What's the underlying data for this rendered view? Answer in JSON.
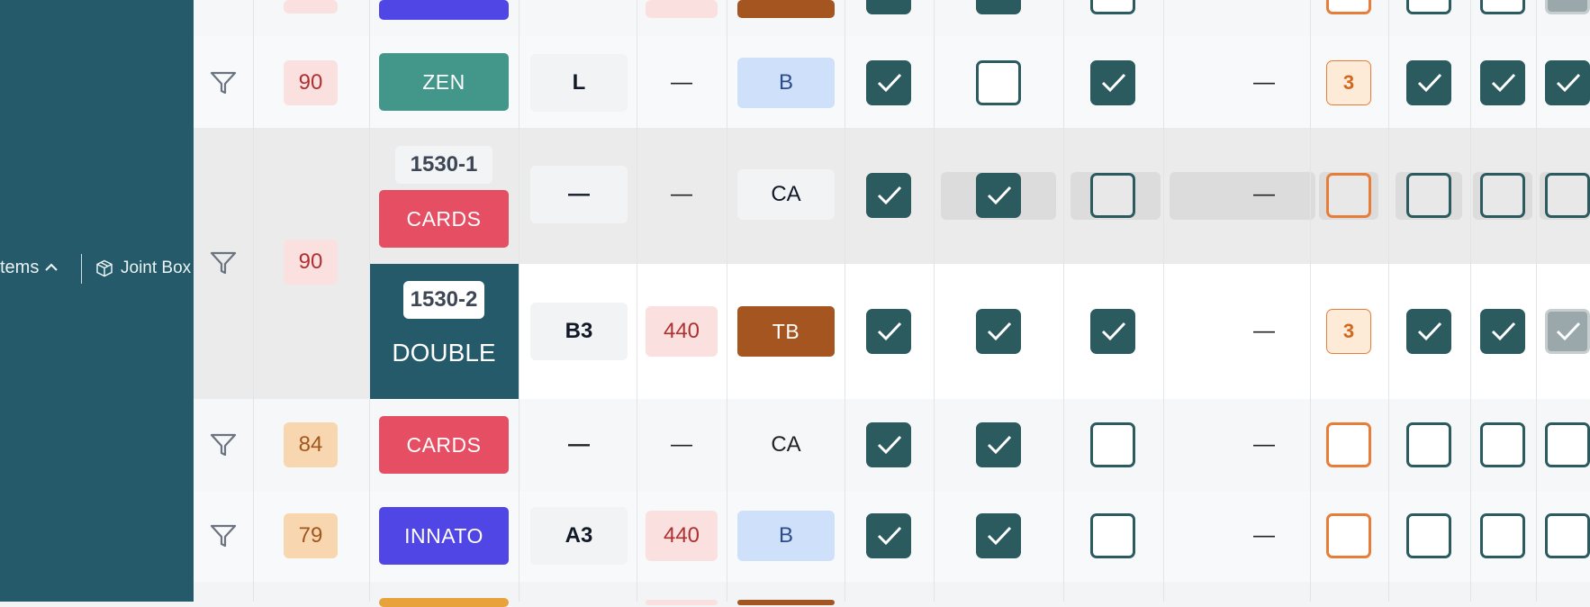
{
  "sidebar": {
    "items_label": "tems",
    "joint_box_label": "Joint Box"
  },
  "rows": {
    "r1": {
      "num": "90",
      "type": "ZEN",
      "size": "L",
      "dash": "—",
      "code": "B",
      "mid_dash": "—",
      "count": "3"
    },
    "group": {
      "num": "90",
      "sub1": {
        "id": "1530-1",
        "type": "CARDS",
        "size": "—",
        "dash": "—",
        "code": "CA",
        "mid_dash": "—"
      },
      "sub2": {
        "id": "1530-2",
        "type": "DOUBLE",
        "size": "B3",
        "len": "440",
        "code": "TB",
        "mid_dash": "—",
        "count": "3"
      }
    },
    "r3": {
      "num": "84",
      "type": "CARDS",
      "size": "—",
      "dash": "—",
      "code": "CA",
      "mid_dash": "—"
    },
    "r4": {
      "num": "79",
      "type": "INNATO",
      "size": "A3",
      "len": "440",
      "code": "B",
      "mid_dash": "—"
    }
  },
  "colors": {
    "sidebar": "#245a69",
    "zen": "#43968a",
    "cards": "#e64e63",
    "innato": "#4f46e5",
    "double": "#245a69",
    "tb": "#a55520",
    "checkbox": "#2b5a5f",
    "orange": "#e67e3a"
  }
}
